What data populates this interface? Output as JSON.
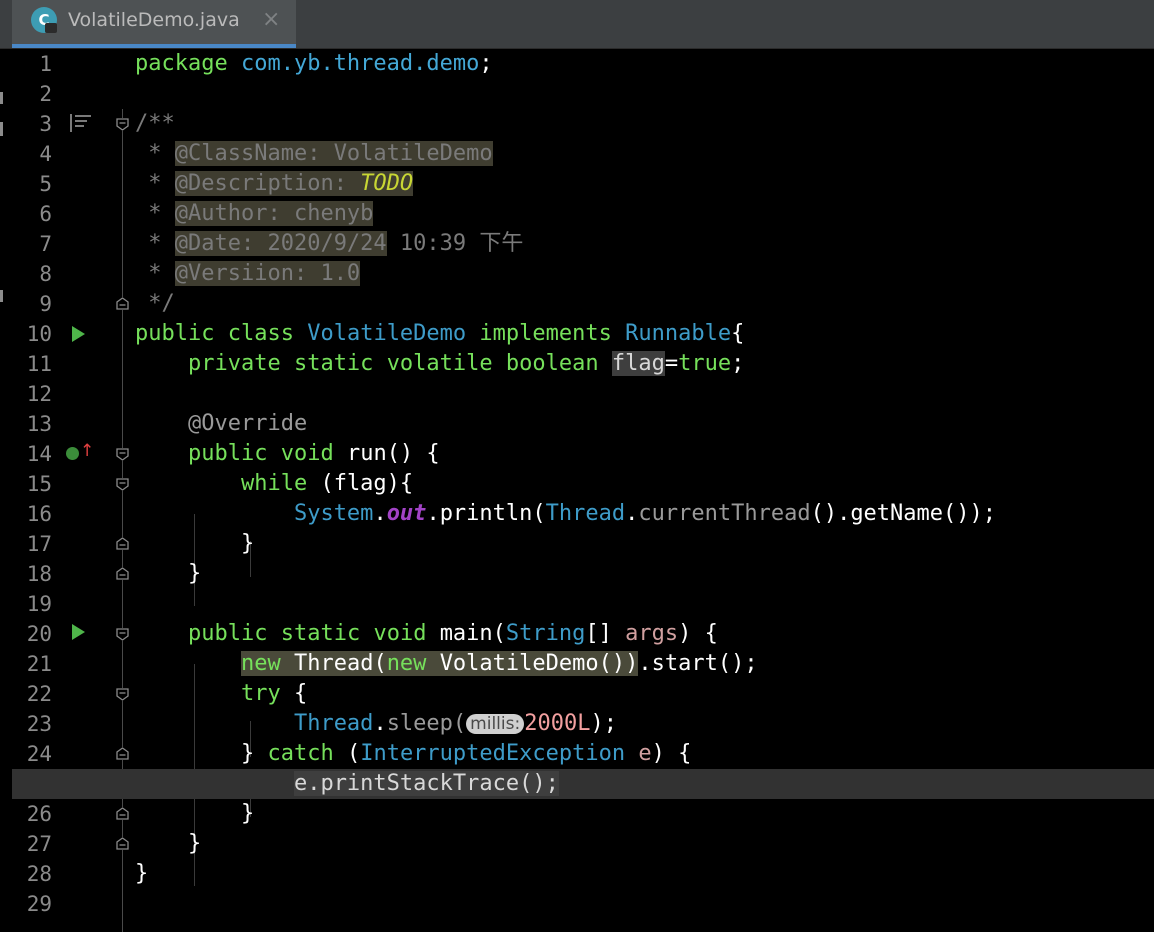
{
  "tab": {
    "title": "VolatileDemo.java",
    "icon_letter": "C",
    "close": "×"
  },
  "colors": {
    "keyword": "#76e05b",
    "type": "#3e9cc9",
    "comment": "#7a7a7a",
    "todo": "#c8d634",
    "static_field": "#a243c6",
    "number": "#f3a0a0",
    "background": "#000000",
    "current_line": "#323232"
  },
  "code": {
    "lines": [
      {
        "n": "1"
      },
      {
        "n": "2"
      },
      {
        "n": "3"
      },
      {
        "n": "4"
      },
      {
        "n": "5"
      },
      {
        "n": "6"
      },
      {
        "n": "7"
      },
      {
        "n": "8"
      },
      {
        "n": "9"
      },
      {
        "n": "10"
      },
      {
        "n": "11"
      },
      {
        "n": "12"
      },
      {
        "n": "13"
      },
      {
        "n": "14"
      },
      {
        "n": "15"
      },
      {
        "n": "16"
      },
      {
        "n": "17"
      },
      {
        "n": "18"
      },
      {
        "n": "19"
      },
      {
        "n": "20"
      },
      {
        "n": "21"
      },
      {
        "n": "22"
      },
      {
        "n": "23"
      },
      {
        "n": "24"
      },
      {
        "n": ""
      },
      {
        "n": "26"
      },
      {
        "n": "27"
      },
      {
        "n": "28"
      },
      {
        "n": "29"
      }
    ],
    "t": {
      "package": "package",
      "pkg_name": "com.yb.thread.demo",
      "semi": ";",
      "doc_open": "/**",
      "star": " * ",
      "class_name_tag": "@ClassName: VolatileDemo",
      "desc_tag": "@Description: ",
      "todo": "TODO",
      "author_tag": "@Author: chenyb",
      "date_tag": "@Date: 2020/9/24",
      "date_rest": " 10:39 下午",
      "version_tag": "@Versiion: 1.0",
      "doc_close": " */",
      "public": "public",
      "class": "class",
      "VolatileDemo": "VolatileDemo",
      "implements": "implements",
      "Runnable": "Runnable",
      "brace_open": "{",
      "private": "private",
      "static": "static",
      "volatile": "volatile",
      "boolean": "boolean",
      "flag": "flag",
      "eq": "=",
      "true": "true",
      "override": "@Override",
      "void": "void",
      "run_sig": "run() {",
      "while": "while",
      "flag_cond": " (flag){",
      "System": "System",
      "dot": ".",
      "out": "out",
      "println": "println(",
      "Thread": "Thread",
      "currentThread": "currentThread",
      "getName_tail": "().getName());",
      "brace_close": "}",
      "main": "main(",
      "String": "String",
      "arr": "[] ",
      "args": "args",
      "paren_brace": ") {",
      "new": "new",
      "Thread_paren": "Thread(",
      "VolatileDemo_call": "VolatileDemo())",
      "start_tail": ".start();",
      "try": "try",
      "space_brace": " {",
      "sleep": "sleep(",
      "millis_hint": "millis:",
      "num": "2000L",
      "close_semi": ");",
      "catch_open": "} ",
      "catch": "catch",
      "lparen": " (",
      "InterruptedException": "InterruptedException",
      "e": "e",
      "e_stack": "e.printStackTrace();"
    }
  }
}
